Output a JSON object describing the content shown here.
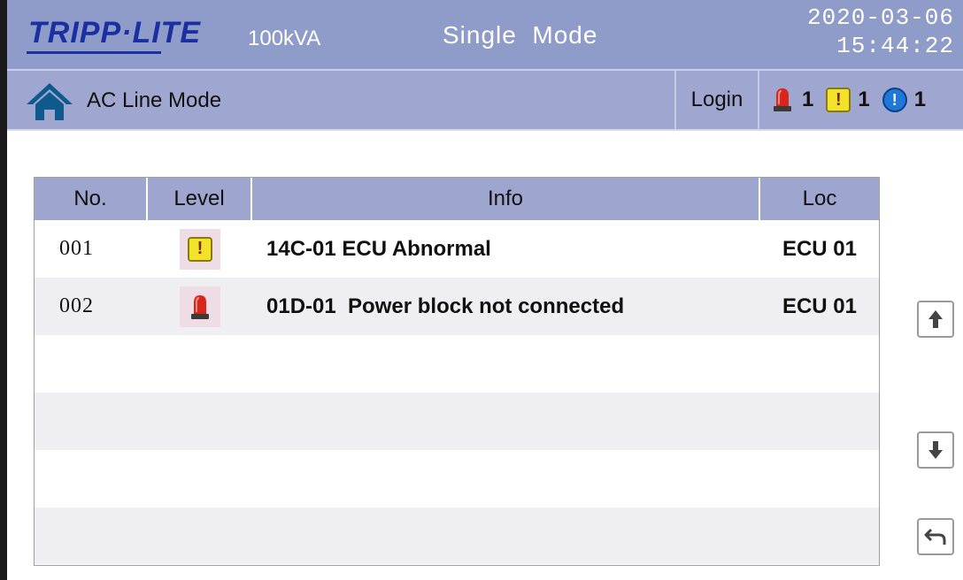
{
  "header": {
    "logo": "TRIPP·LITE",
    "capacity": "100kVA",
    "mode": "Single  Mode",
    "date": "2020-03-06",
    "time": "15:44:22"
  },
  "subheader": {
    "status": "AC Line Mode",
    "login_label": "Login",
    "alarm_count": "1",
    "warning_count": "1",
    "info_count": "1"
  },
  "table": {
    "headers": [
      "No.",
      "Level",
      "Info",
      "Loc"
    ],
    "rows": [
      {
        "no": "001",
        "level": "warning",
        "info": "14C-01 ECU Abnormal",
        "loc": "ECU 01"
      },
      {
        "no": "002",
        "level": "alarm",
        "info": "01D-01  Power block not connected",
        "loc": "ECU 01"
      }
    ]
  },
  "buttons": {
    "up": "arrow-up-icon",
    "down": "arrow-down-icon",
    "back": "return-icon"
  },
  "colors": {
    "topbar": "#8f9cc9",
    "subbar": "#9fa6d0",
    "logo": "#1a2fa0",
    "warning": "#f2e22a",
    "alarm": "#d8261c",
    "info": "#1e78d8"
  }
}
